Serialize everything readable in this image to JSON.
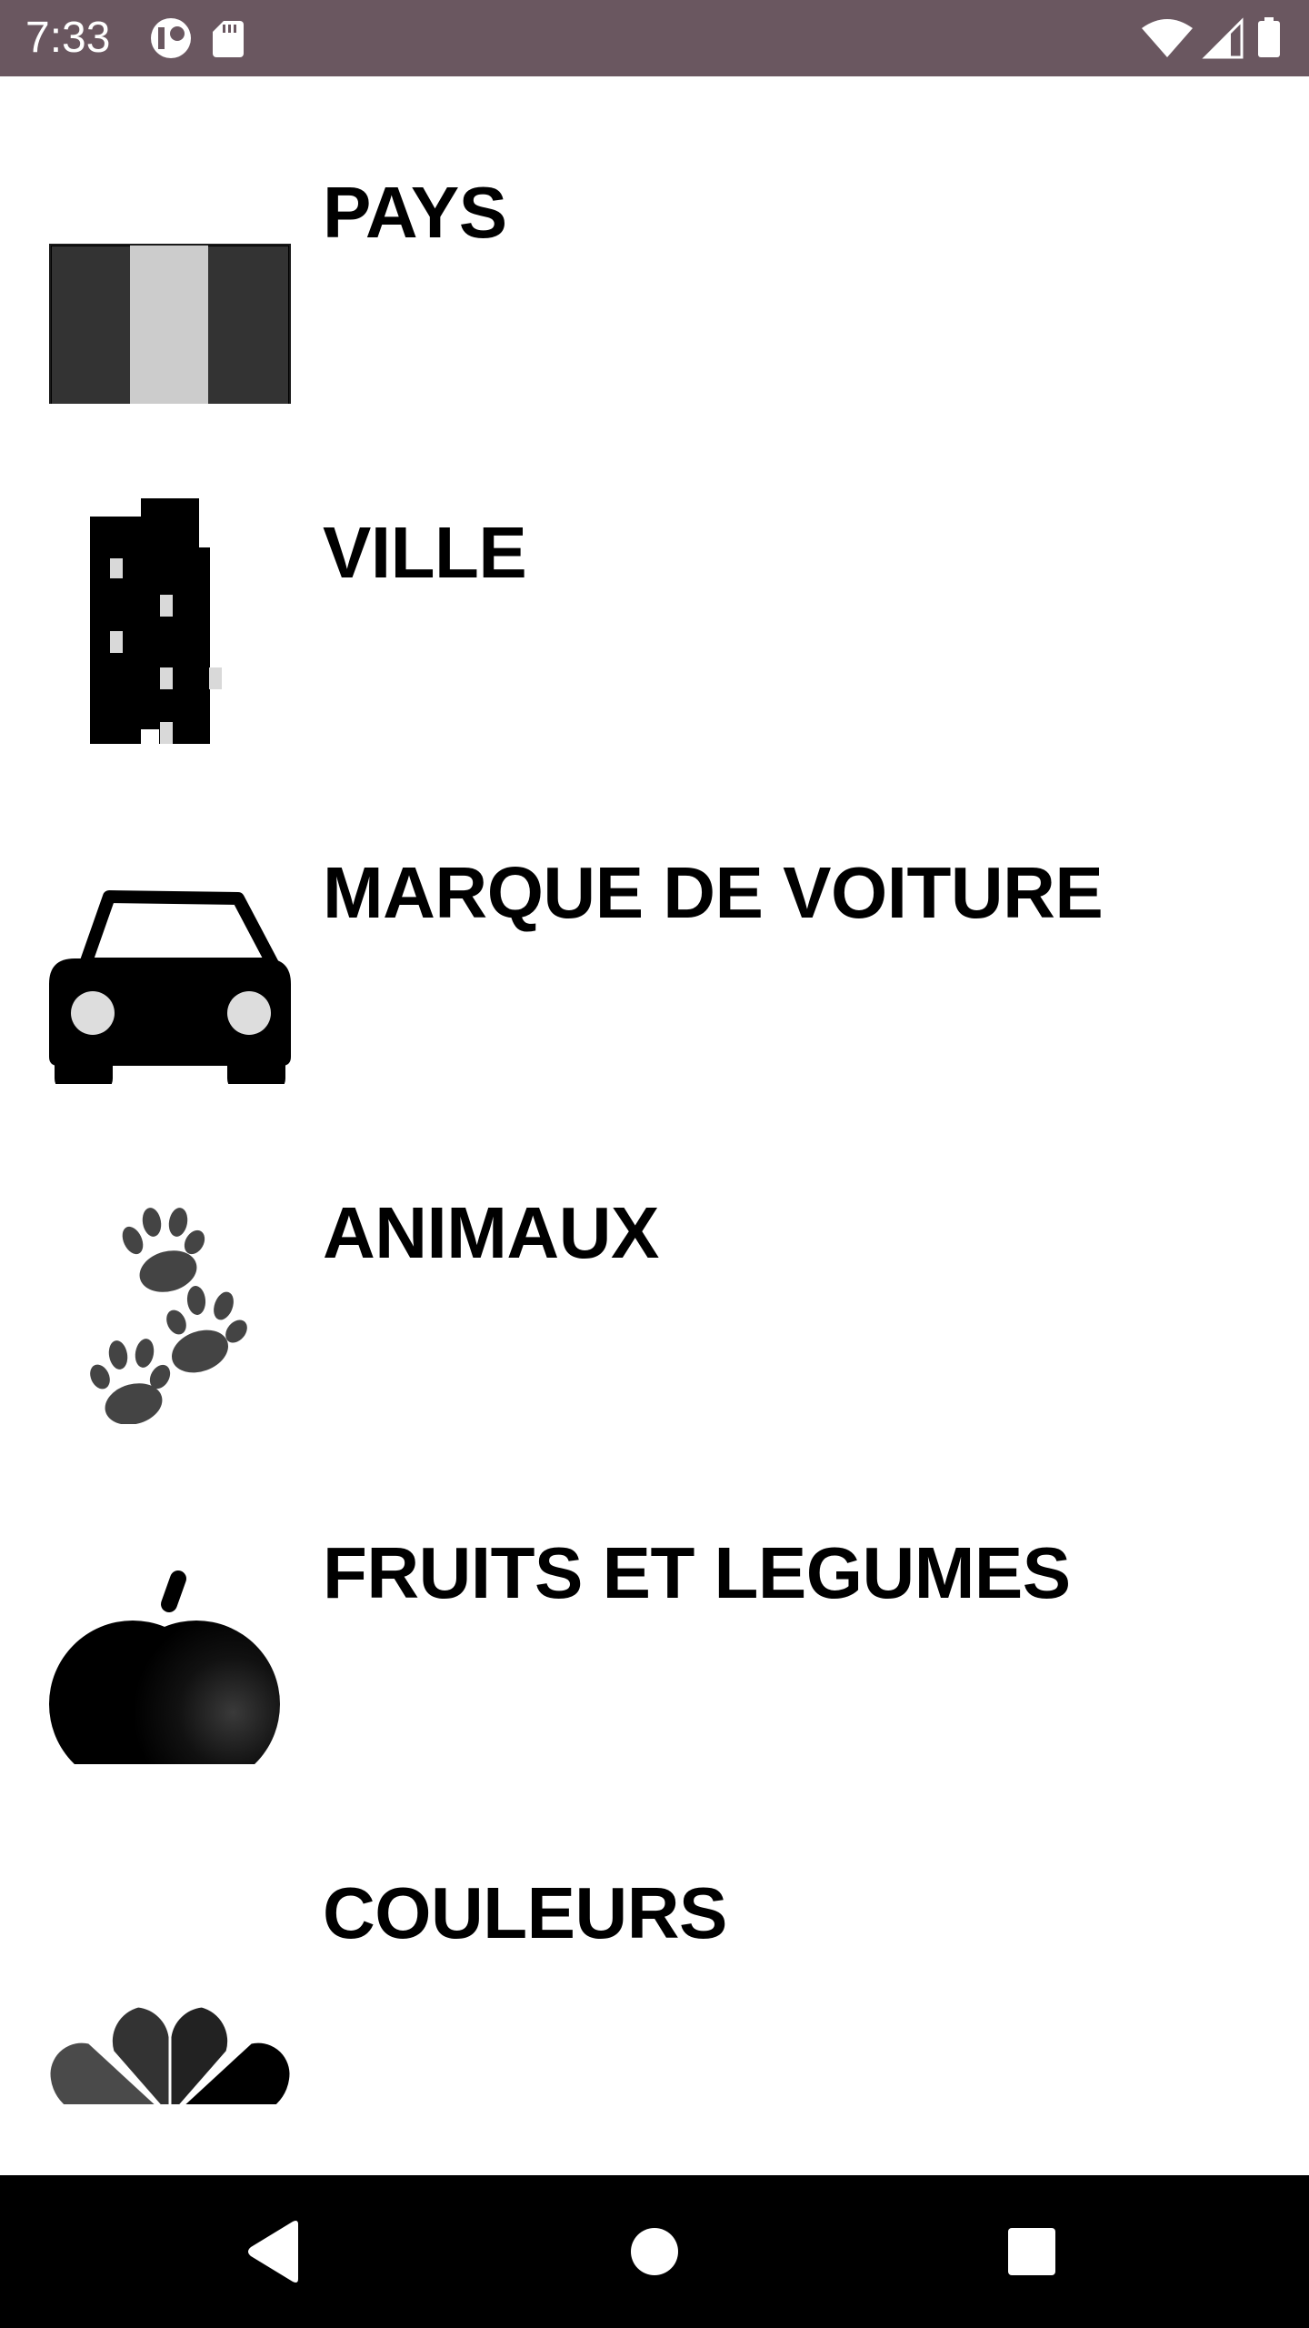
{
  "status_bar": {
    "time": "7:33",
    "background": "#6a5760",
    "left_icons": [
      "data-saver-icon",
      "sd-card-icon"
    ],
    "right_icons": [
      "wifi-icon",
      "cell-signal-icon",
      "battery-icon"
    ]
  },
  "categories": [
    {
      "label": "PAYS",
      "icon": "flag-icon"
    },
    {
      "label": "VILLE",
      "icon": "building-icon"
    },
    {
      "label": "MARQUE DE VOITURE",
      "icon": "car-icon"
    },
    {
      "label": "ANIMAUX",
      "icon": "paw-prints-icon"
    },
    {
      "label": "FRUITS ET LEGUMES",
      "icon": "apple-icon"
    },
    {
      "label": "COULEURS",
      "icon": "peacock-color-icon"
    }
  ],
  "nav_bar": {
    "buttons": [
      "back-icon",
      "home-icon",
      "recents-icon"
    ]
  }
}
